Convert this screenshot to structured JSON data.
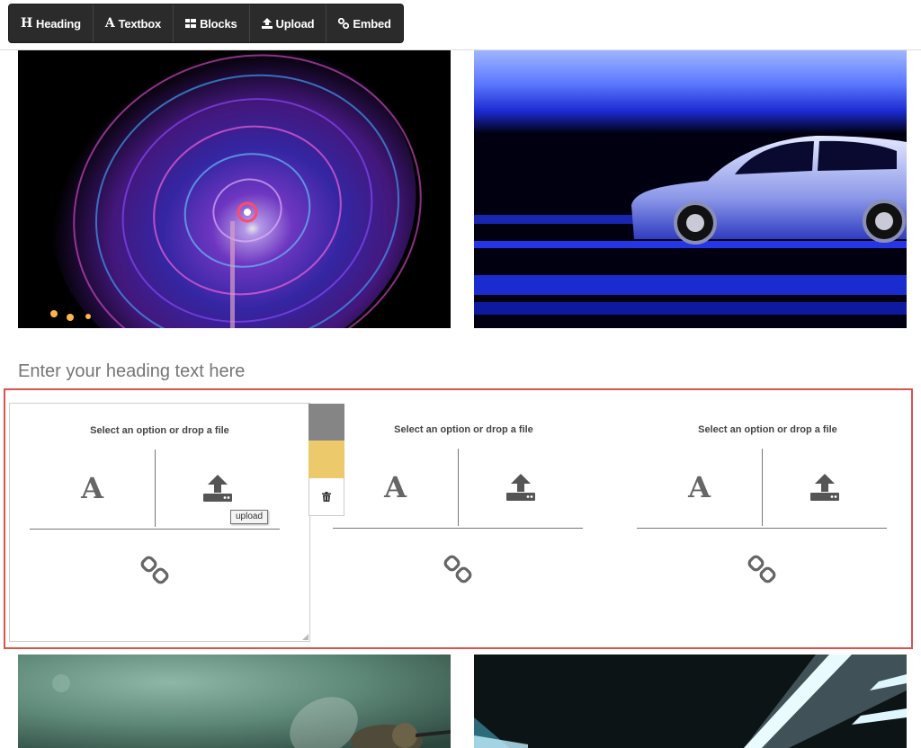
{
  "toolbar": {
    "items": [
      {
        "icon": "H",
        "label": "Heading"
      },
      {
        "icon": "A",
        "label": "Textbox"
      },
      {
        "icon": "blocks-icon",
        "label": "Blocks"
      },
      {
        "icon": "upload-icon",
        "label": "Upload"
      },
      {
        "icon": "link-icon",
        "label": "Embed"
      }
    ]
  },
  "heading": {
    "placeholder": "Enter your heading text here"
  },
  "blocks": [
    {
      "title": "Select an option or drop a file",
      "text_glyph": "A"
    },
    {
      "title": "Select an option or drop a file",
      "text_glyph": "A"
    },
    {
      "title": "Select an option or drop a file",
      "text_glyph": "A"
    }
  ],
  "tooltip": {
    "text": "upload"
  },
  "colors": {
    "toolbar_bg": "#2b2b2b",
    "selection_border": "#d9534f",
    "swatch_grey": "#858585",
    "swatch_yellow": "#ecca6b"
  }
}
